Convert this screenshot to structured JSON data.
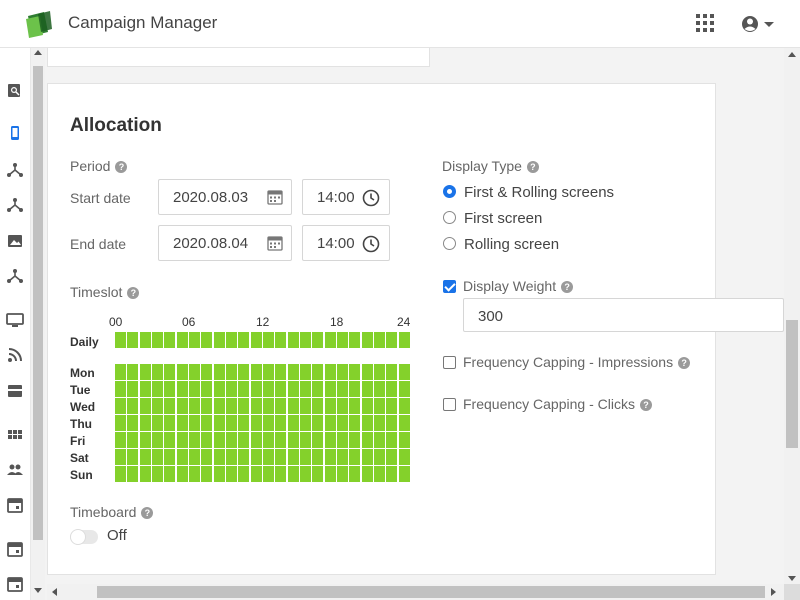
{
  "header": {
    "app_title": "Campaign Manager",
    "icons": [
      "app-logo",
      "apps-grid-icon",
      "user-account-icon",
      "caret-down-icon"
    ]
  },
  "sidebar": {
    "icons": [
      "search-icon",
      "mobile-icon",
      "network-icon",
      "network-icon",
      "image-icon",
      "network-icon",
      "monitor-icon",
      "rss-icon",
      "card-icon",
      "grid-icon",
      "people-icon",
      "calendar-icon",
      "calendar-icon",
      "calendar-icon"
    ]
  },
  "allocation": {
    "title": "Allocation",
    "period_label": "Period",
    "start_label": "Start date",
    "end_label": "End date",
    "start_date": "2020.08.03",
    "start_time": "14:00",
    "end_date": "2020.08.04",
    "end_time": "14:00",
    "timeslot_label": "Timeslot",
    "hour_marks": [
      "00",
      "06",
      "12",
      "18",
      "24"
    ],
    "daily_label": "Daily",
    "days": [
      "Mon",
      "Tue",
      "Wed",
      "Thu",
      "Fri",
      "Sat",
      "Sun"
    ],
    "slots_per_row": 24,
    "slot_color": "#84d12b",
    "all_slots_selected": true,
    "timeboard_label": "Timeboard",
    "timeboard_state": "Off",
    "display_type_label": "Display Type",
    "display_types": [
      "First & Rolling screens",
      "First screen",
      "Rolling screen"
    ],
    "display_type_selected": 0,
    "display_weight_label": "Display Weight",
    "display_weight_checked": true,
    "display_weight_value": "300",
    "freq_impressions_label": "Frequency Capping - Impressions",
    "freq_impressions_checked": false,
    "freq_clicks_label": "Frequency Capping - Clicks",
    "freq_clicks_checked": false
  },
  "colors": {
    "accent": "#1a73e8",
    "slot_green": "#84d12b"
  }
}
